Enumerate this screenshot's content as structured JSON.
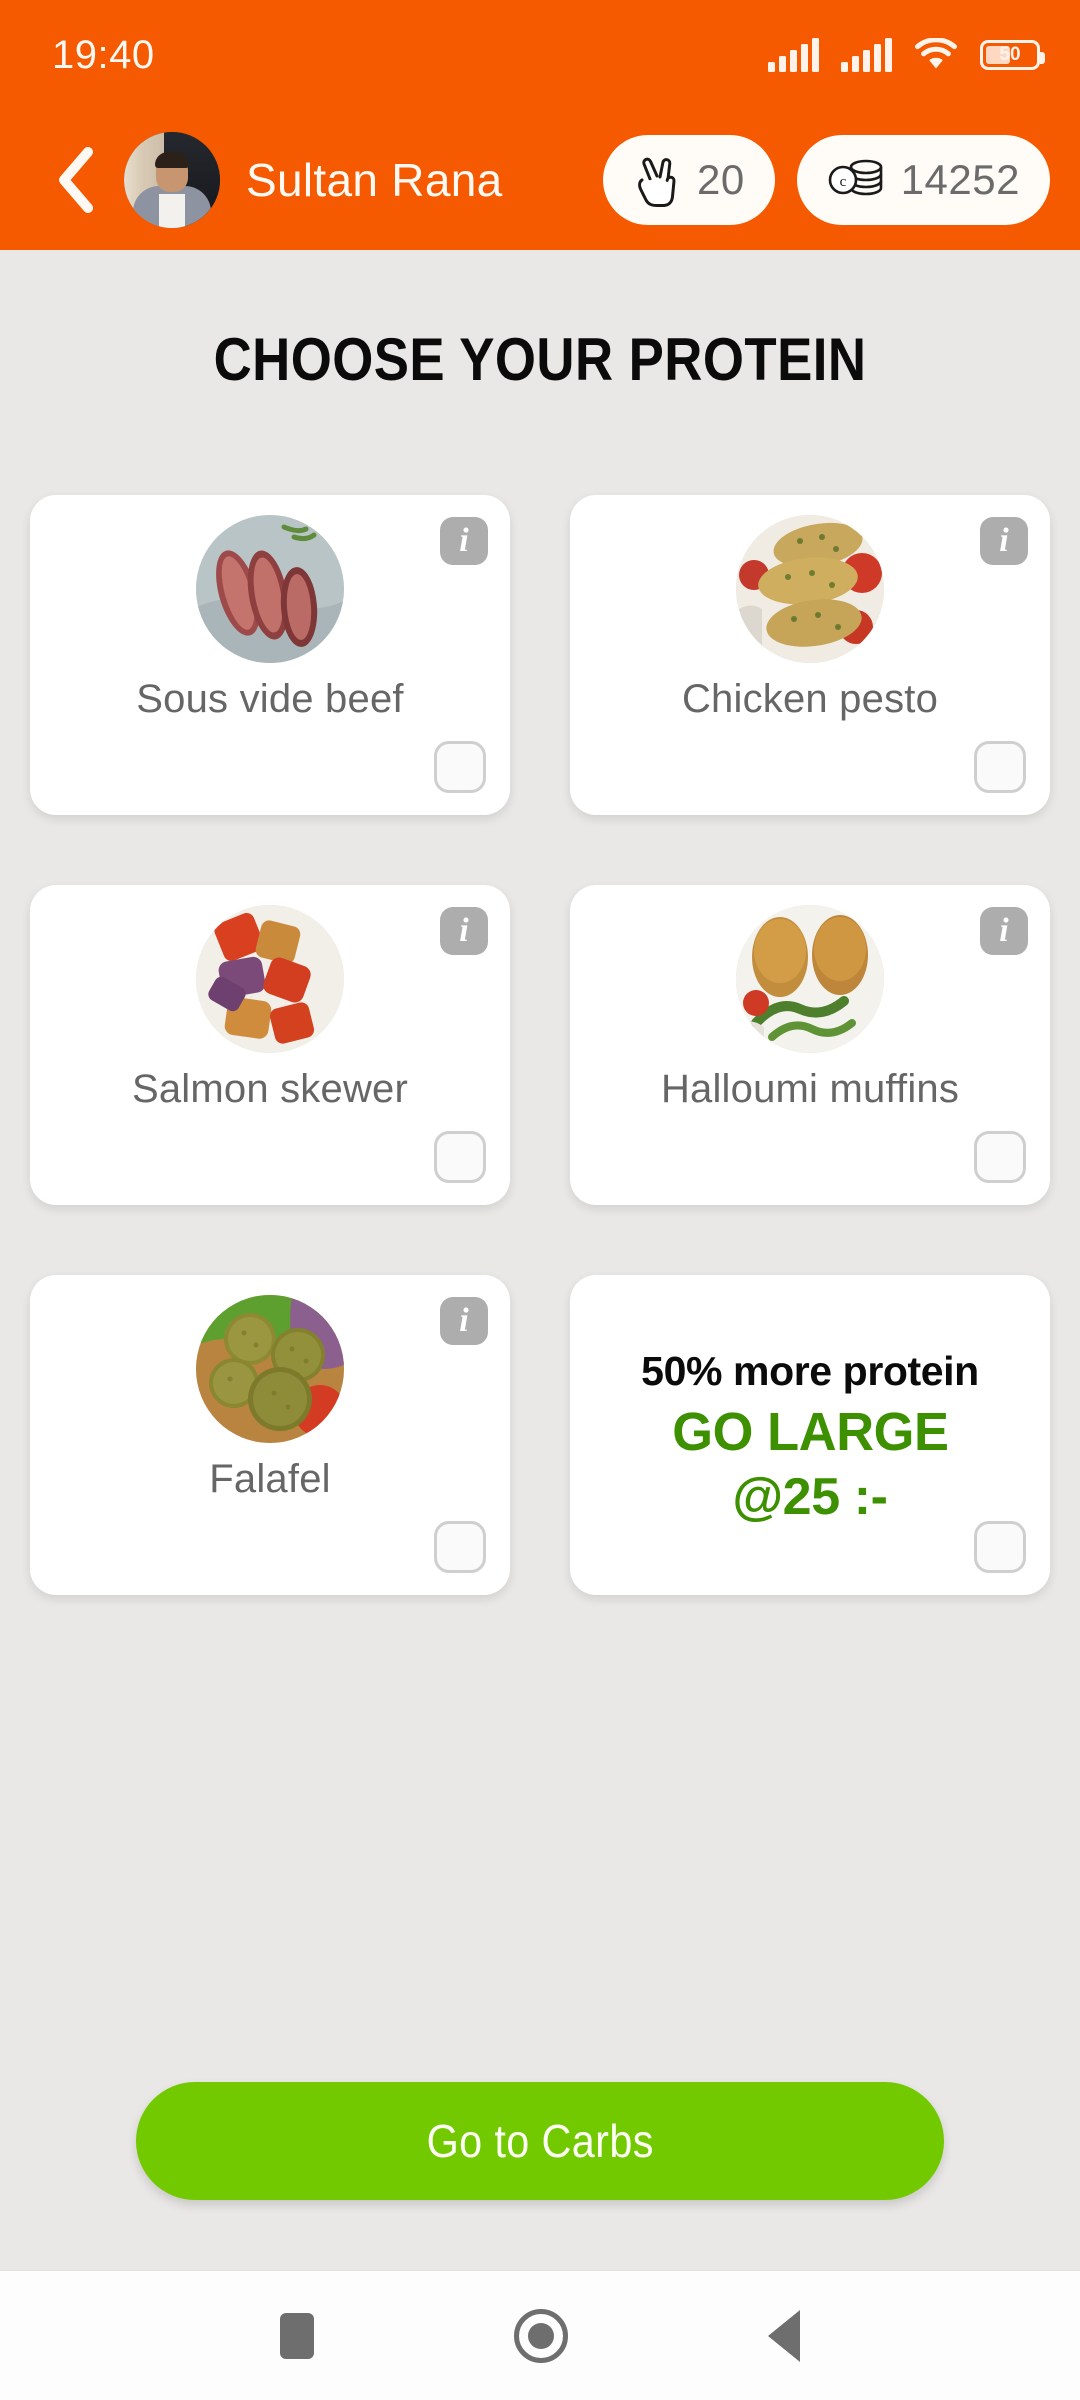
{
  "status_bar": {
    "clock": "19:40",
    "signal_1": "signal-bars-icon",
    "signal_2": "signal-bars-icon",
    "wifi": "wifi-icon",
    "battery_level": "50"
  },
  "header": {
    "back": "back-chevron-icon",
    "avatar_alt": "user-avatar",
    "username": "Sultan Rana",
    "chips": [
      {
        "icon": "peace-hand-icon",
        "value": "20"
      },
      {
        "icon": "coins-stack-icon",
        "value": "14252"
      }
    ]
  },
  "main": {
    "title": "CHOOSE YOUR PROTEIN",
    "options": [
      {
        "label": "Sous vide beef",
        "info": "i",
        "selected": false
      },
      {
        "label": "Chicken pesto",
        "info": "i",
        "selected": false
      },
      {
        "label": "Salmon skewer",
        "info": "i",
        "selected": false
      },
      {
        "label": "Halloumi muffins",
        "info": "i",
        "selected": false
      },
      {
        "label": "Falafel",
        "info": "i",
        "selected": false
      }
    ],
    "promo": {
      "line1": "50% more protein",
      "line2": "GO LARGE",
      "line3": "@25 :-",
      "selected": false
    }
  },
  "cta": {
    "label": "Go to Carbs"
  },
  "nav_bar": {
    "recents": "square-recents-icon",
    "home": "circle-home-icon",
    "back": "triangle-back-icon"
  },
  "colors": {
    "brand_orange": "#F55A00",
    "background": "#EAE8E6",
    "card": "#FFFFFF",
    "accent_green": "#72C900",
    "promo_green": "#3D9000",
    "label_gray": "#666666",
    "info_gray": "#ADADAD"
  }
}
